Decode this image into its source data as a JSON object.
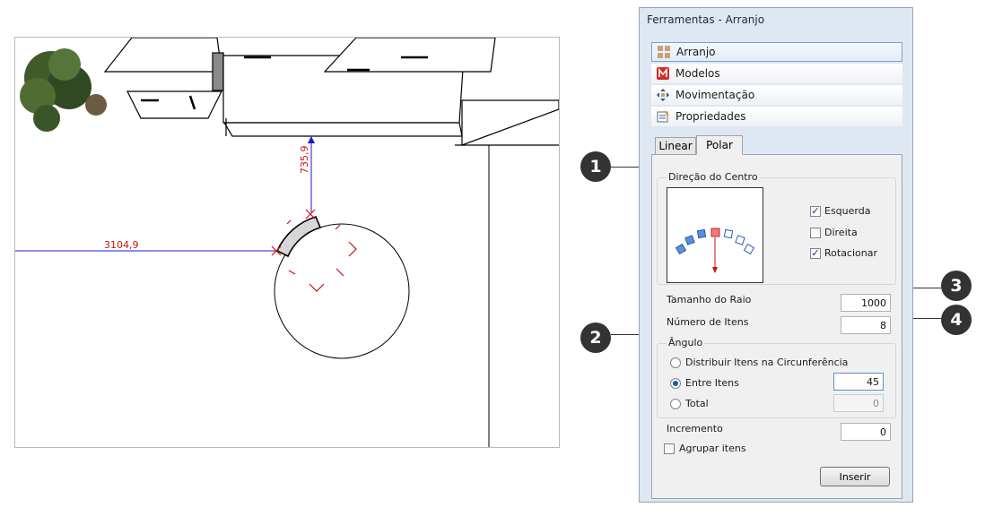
{
  "canvas": {
    "dimension_horizontal": "3104,9",
    "dimension_vertical": "735,9"
  },
  "panel": {
    "title": "Ferramentas - Arranjo",
    "nav": [
      {
        "label": "Arranjo",
        "icon": "arrange-icon",
        "selected": true
      },
      {
        "label": "Modelos",
        "icon": "models-icon",
        "selected": false
      },
      {
        "label": "Movimentação",
        "icon": "move-icon",
        "selected": false
      },
      {
        "label": "Propriedades",
        "icon": "properties-icon",
        "selected": false
      }
    ],
    "tabs": {
      "linear": "Linear",
      "polar": "Polar",
      "active": "Polar"
    },
    "direction_group": "Direção do Centro",
    "checks": {
      "left": {
        "label": "Esquerda",
        "checked": true
      },
      "right": {
        "label": "Direita",
        "checked": false
      },
      "rotate": {
        "label": "Rotacionar",
        "checked": true
      }
    },
    "radius": {
      "label": "Tamanho do Raio",
      "value": "1000"
    },
    "items_count": {
      "label": "Número de Itens",
      "value": "8"
    },
    "angle_group": "Ângulo",
    "angle": {
      "distribute": {
        "label": "Distribuir Itens na Circunferência",
        "selected": false
      },
      "between": {
        "label": "Entre Itens",
        "selected": true,
        "value": "45"
      },
      "total": {
        "label": "Total",
        "selected": false,
        "value": "0"
      }
    },
    "increment": {
      "label": "Incremento",
      "value": "0"
    },
    "group_items": {
      "label": "Agrupar itens",
      "checked": false
    },
    "insert_button": "Inserir"
  },
  "callouts": [
    "1",
    "2",
    "3",
    "4"
  ],
  "colors": {
    "accent": "#cc1111",
    "dimension": "#1a1acc",
    "panel_bg": "#dfe7f2"
  }
}
